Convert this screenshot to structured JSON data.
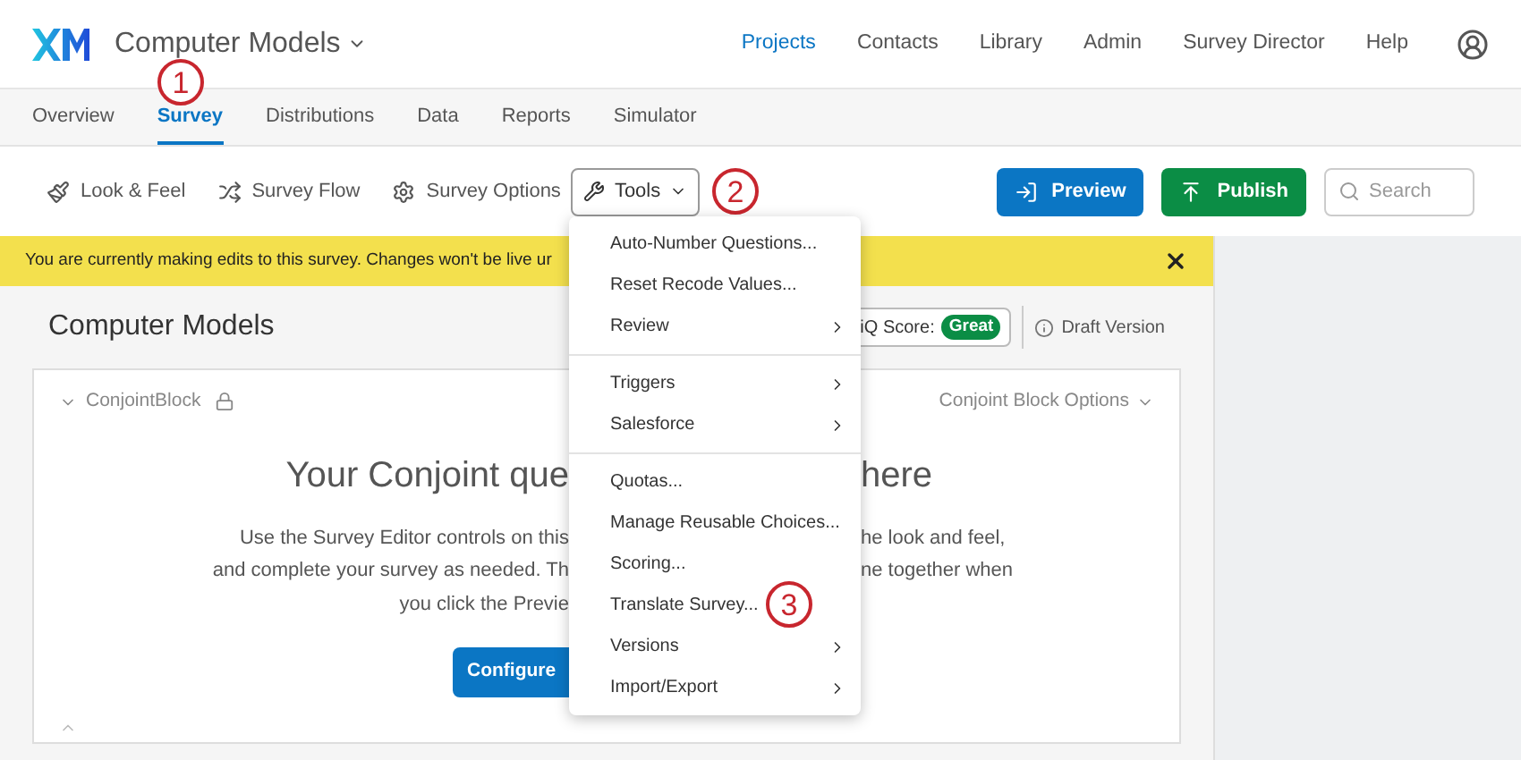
{
  "project": {
    "title": "Computer Models"
  },
  "top_nav": [
    {
      "label": "Projects",
      "selected": true
    },
    {
      "label": "Contacts",
      "selected": false
    },
    {
      "label": "Library",
      "selected": false
    },
    {
      "label": "Admin",
      "selected": false
    },
    {
      "label": "Survey Director",
      "selected": false
    },
    {
      "label": "Help",
      "selected": false
    }
  ],
  "tabs": [
    {
      "label": "Overview",
      "selected": false
    },
    {
      "label": "Survey",
      "selected": true
    },
    {
      "label": "Distributions",
      "selected": false
    },
    {
      "label": "Data",
      "selected": false
    },
    {
      "label": "Reports",
      "selected": false
    },
    {
      "label": "Simulator",
      "selected": false
    }
  ],
  "toolbar": {
    "look_feel": "Look & Feel",
    "survey_flow": "Survey Flow",
    "survey_options": "Survey Options",
    "tools": "Tools",
    "preview": "Preview",
    "publish": "Publish",
    "search_placeholder": "Search"
  },
  "banner": {
    "text": "You are currently making edits to this survey. Changes won't be live ur"
  },
  "survey": {
    "title": "Computer Models",
    "iq_label": "iQ Score:",
    "iq_badge": "Great",
    "draft": "Draft Version"
  },
  "block": {
    "name": "ConjointBlock",
    "options": "Conjoint Block Options",
    "title_left": "Your Conjoint que",
    "title_right": "here",
    "lines": [
      {
        "left": "Use the Survey Editor controls on this",
        "right": "he look and feel,"
      },
      {
        "left": "and complete your survey as needed. Th",
        "right": "ne together when"
      },
      {
        "left": "you click the Previe"
      }
    ],
    "button": "Configure"
  },
  "menu": [
    {
      "label": "Auto-Number Questions...",
      "submenu": false,
      "divider_before": false
    },
    {
      "label": "Reset Recode Values...",
      "submenu": false,
      "divider_before": false
    },
    {
      "label": "Review",
      "submenu": true,
      "divider_before": false
    },
    {
      "label": "Triggers",
      "submenu": true,
      "divider_before": true
    },
    {
      "label": "Salesforce",
      "submenu": true,
      "divider_before": false
    },
    {
      "label": "Quotas...",
      "submenu": false,
      "divider_before": true
    },
    {
      "label": "Manage Reusable Choices...",
      "submenu": false,
      "divider_before": false
    },
    {
      "label": "Scoring...",
      "submenu": false,
      "divider_before": false
    },
    {
      "label": "Translate Survey...",
      "submenu": false,
      "divider_before": false,
      "callout": "3"
    },
    {
      "label": "Versions",
      "submenu": true,
      "divider_before": false
    },
    {
      "label": "Import/Export",
      "submenu": true,
      "divider_before": false
    }
  ],
  "callouts": [
    "1",
    "2"
  ]
}
